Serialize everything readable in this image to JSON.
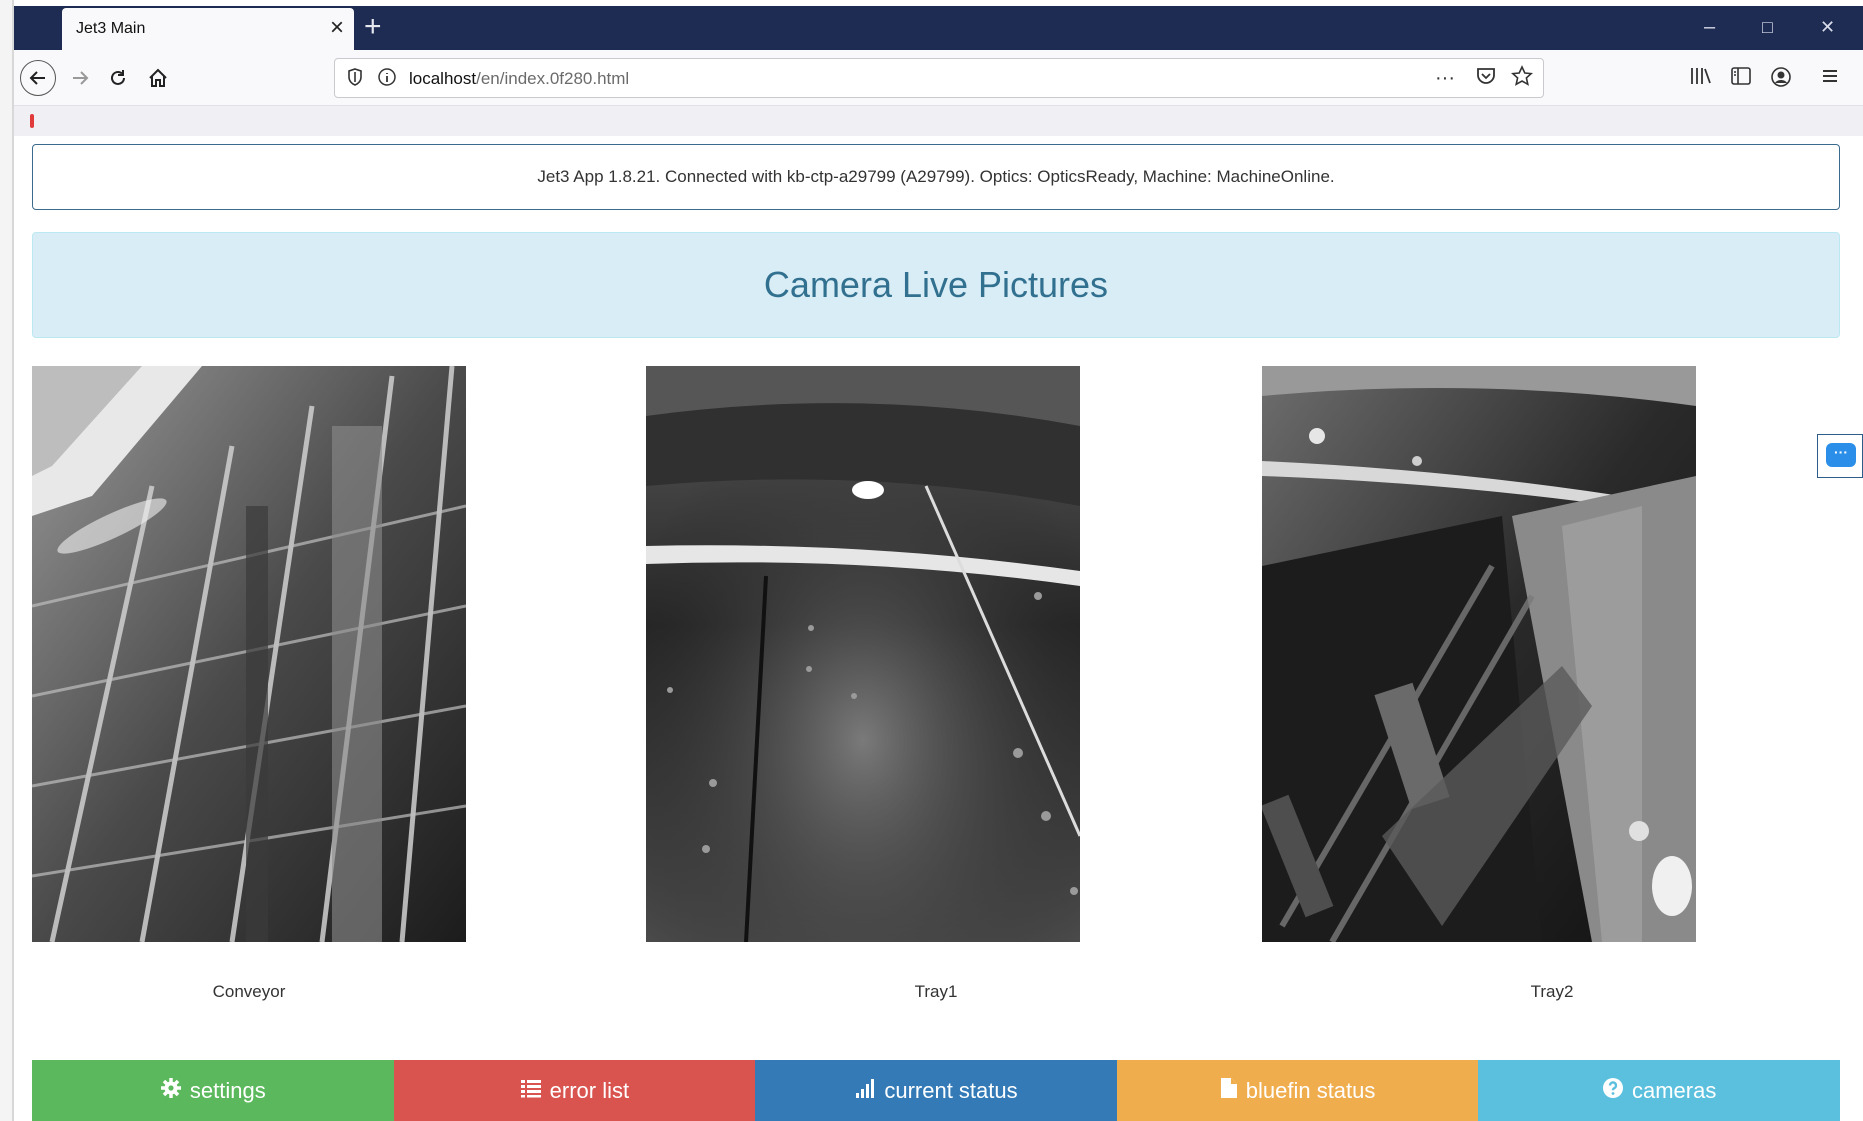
{
  "browser": {
    "tab_title": "Jet3 Main",
    "tab_close": "×",
    "new_tab": "+",
    "minimize": "–",
    "maximize": "□",
    "close": "✕",
    "url_host": "localhost",
    "url_path": "/en/index.0f280.html",
    "url_more": "···"
  },
  "status": {
    "text": "Jet3 App 1.8.21. Connected with kb-ctp-a29799 (A29799). Optics: OpticsReady, Machine: MachineOnline."
  },
  "banner": {
    "title": "Camera Live Pictures"
  },
  "cameras": [
    {
      "label": "Conveyor"
    },
    {
      "label": "Tray1"
    },
    {
      "label": "Tray2"
    }
  ],
  "buttons": [
    {
      "label": "settings",
      "icon": "gear-icon",
      "color": "#5cb85c"
    },
    {
      "label": "error list",
      "icon": "list-icon",
      "color": "#d9534f"
    },
    {
      "label": "current status",
      "icon": "signal-bars-icon",
      "color": "#337ab7"
    },
    {
      "label": "bluefin status",
      "icon": "document-icon",
      "color": "#f0ad4e"
    },
    {
      "label": "cameras",
      "icon": "question-circle-icon",
      "color": "#5bc0de"
    }
  ],
  "chat": {
    "glyph": "···"
  }
}
